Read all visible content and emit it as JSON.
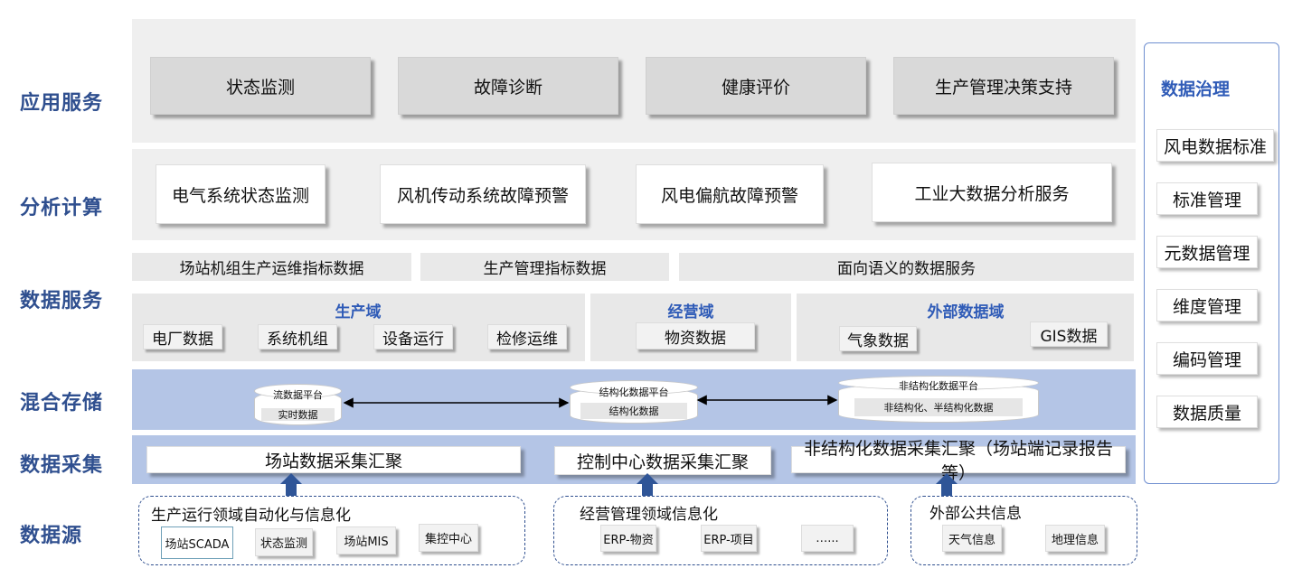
{
  "layers": {
    "app": "应用服务",
    "analysis": "分析计算",
    "data_service": "数据服务",
    "storage": "混合存储",
    "collection": "数据采集",
    "source": "数据源"
  },
  "app_services": [
    "状态监测",
    "故障诊断",
    "健康评价",
    "生产管理决策支持"
  ],
  "analysis_services": [
    "电气系统状态监测",
    "风机传动系统故障预警",
    "风电偏航故障预警",
    "工业大数据分析服务"
  ],
  "data_service": {
    "strips": [
      "场站机组生产运维指标数据",
      "生产管理指标数据",
      "面向语义的数据服务"
    ],
    "production_domain": {
      "title": "生产域",
      "items": [
        "电厂数据",
        "系统机组",
        "设备运行",
        "检修运维"
      ]
    },
    "business_domain": {
      "title": "经营域",
      "items": [
        "物资数据"
      ]
    },
    "external_domain": {
      "title": "外部数据域",
      "items": [
        "气象数据",
        "GIS数据"
      ]
    }
  },
  "storage": {
    "stream": {
      "title": "流数据平台",
      "inner": "实时数据"
    },
    "structured": {
      "title": "结构化数据平台",
      "inner": "结构化数据"
    },
    "unstructured": {
      "title": "非结构化数据平台",
      "inner": "非结构化、半结构化数据"
    }
  },
  "collection": [
    "场站数据采集汇聚",
    "控制中心数据采集汇聚",
    "非结构化数据采集汇聚（场站端记录报告等）"
  ],
  "sources": {
    "production": {
      "title": "生产运行领域自动化与信息化",
      "items": [
        "场站SCADA",
        "状态监测",
        "场站MIS",
        "集控中心"
      ]
    },
    "business": {
      "title": "经营管理领域信息化",
      "items": [
        "ERP-物资",
        "ERP-项目",
        "…..."
      ]
    },
    "external": {
      "title": "外部公共信息",
      "items": [
        "天气信息",
        "地理信息"
      ]
    }
  },
  "governance": {
    "title": "数据治理",
    "items": [
      "风电数据标准",
      "标准管理",
      "元数据管理",
      "维度管理",
      "编码管理",
      "数据质量"
    ]
  },
  "colors": {
    "accent": "#2F4F8F",
    "band_blue": "#b4c5e6",
    "arrow": "#2F5597"
  }
}
